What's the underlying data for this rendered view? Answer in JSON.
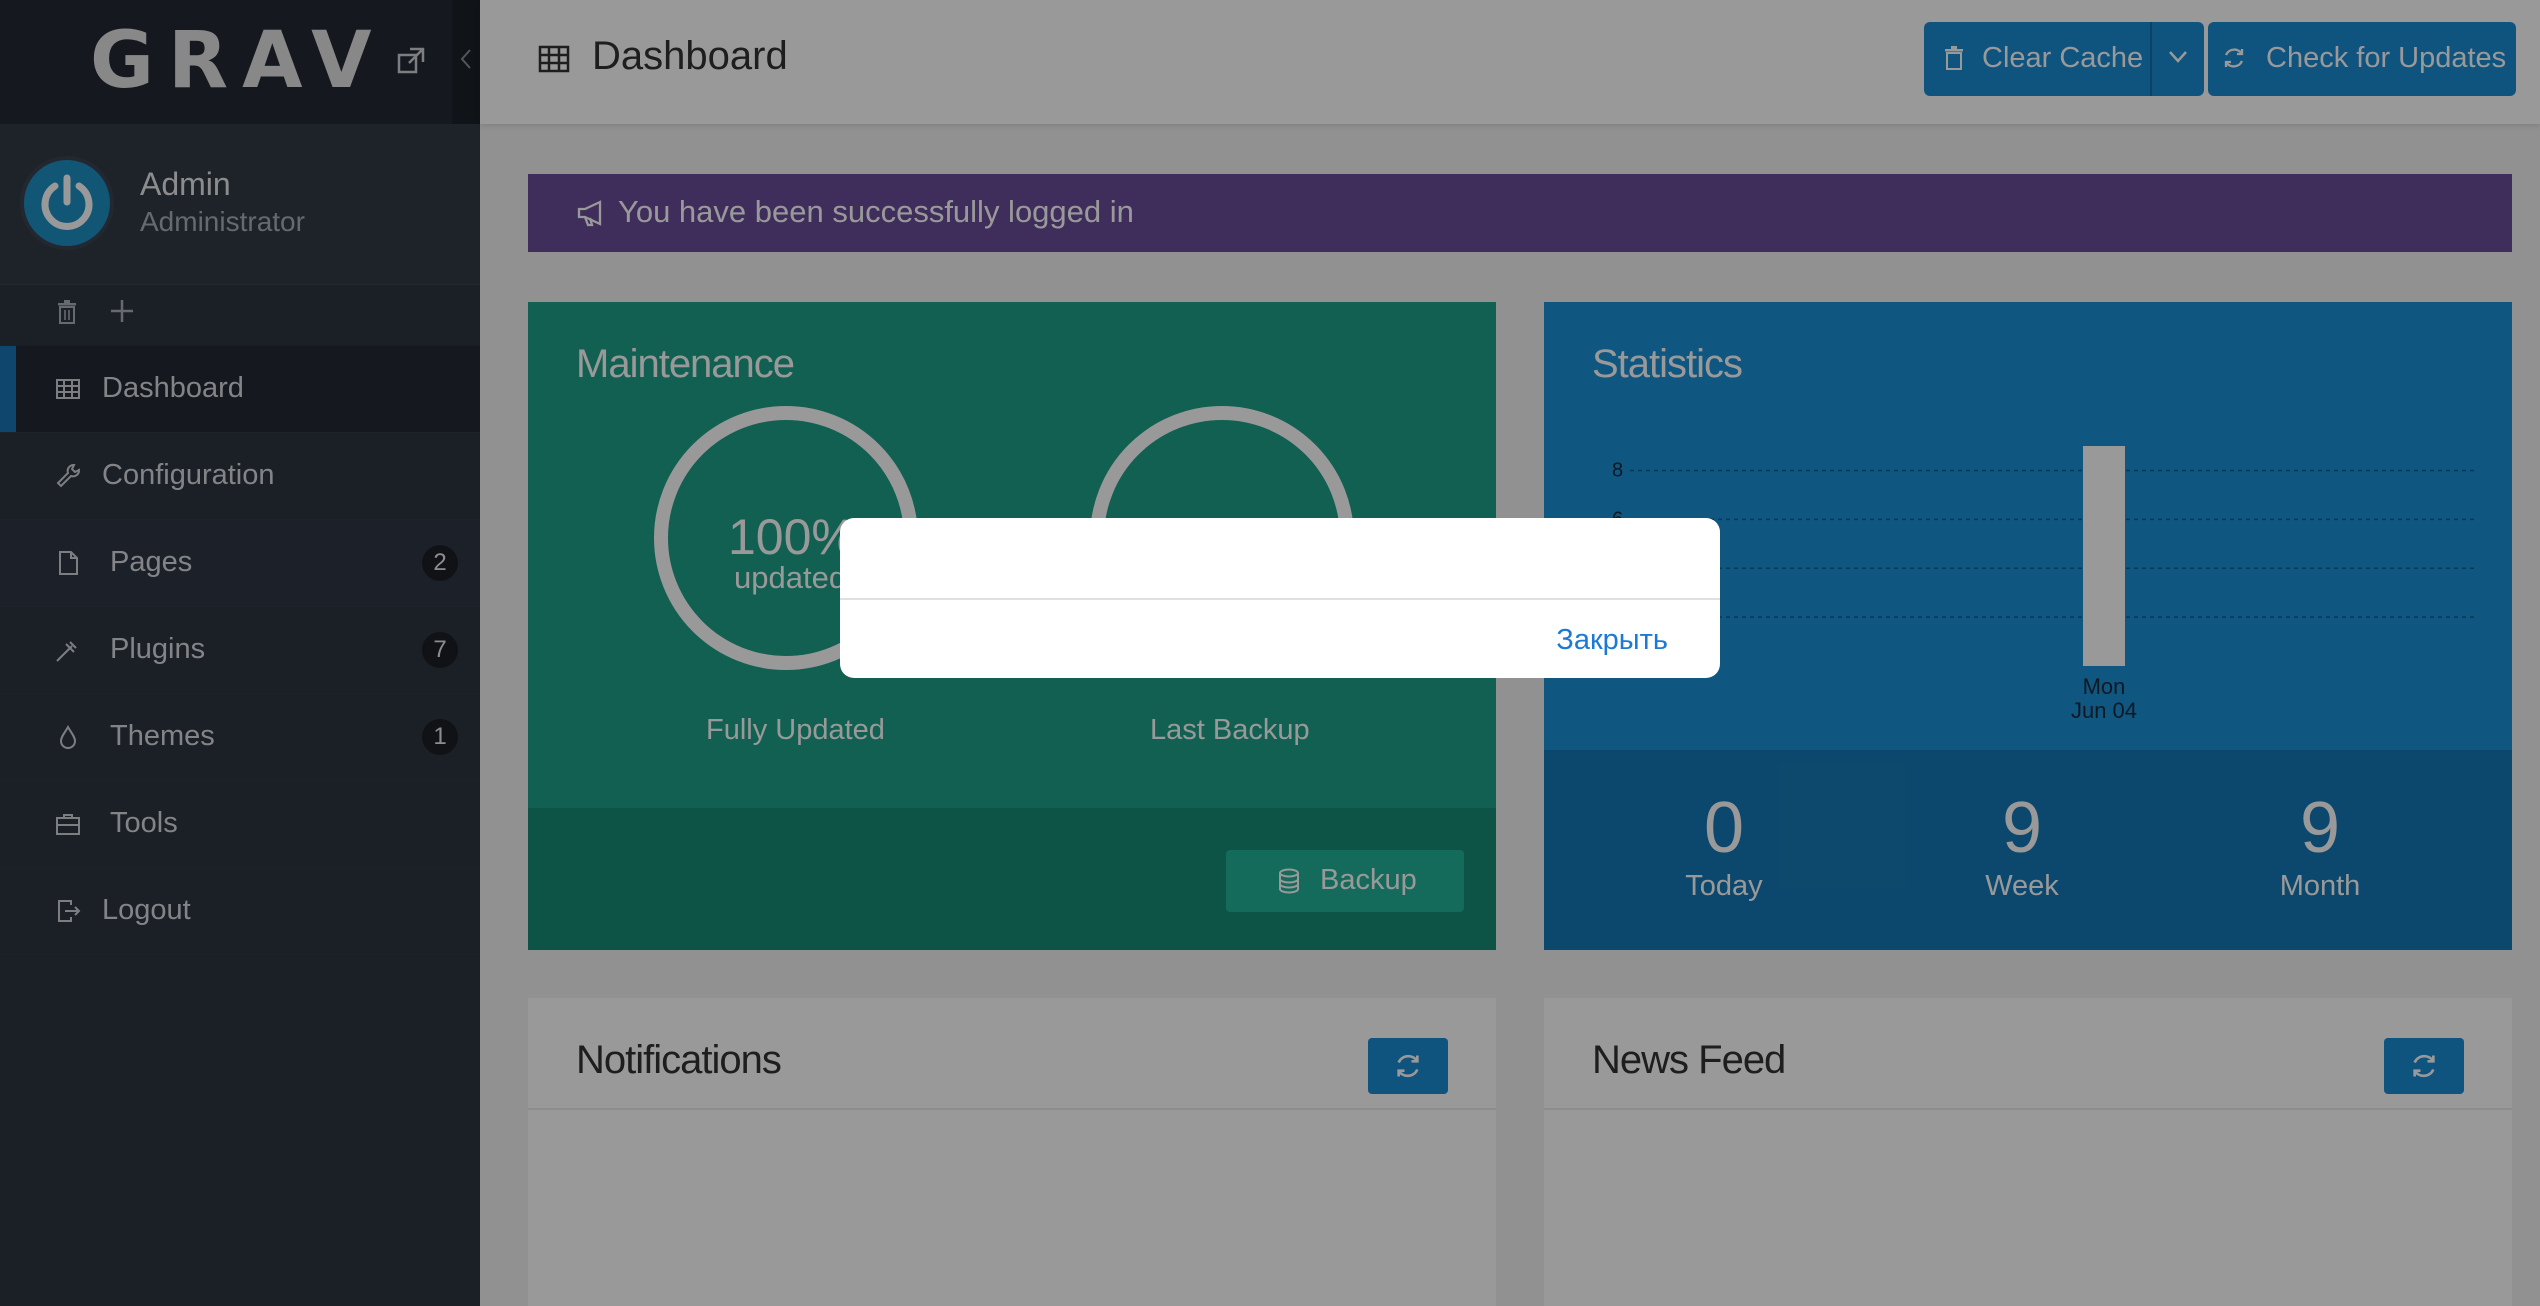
{
  "sidebar": {
    "logo": "GRAV",
    "user": {
      "name": "Admin",
      "role": "Administrator"
    },
    "nav": [
      {
        "label": "Dashboard",
        "icon": "dashboard-icon",
        "active": true
      },
      {
        "label": "Configuration",
        "icon": "wrench-icon"
      },
      {
        "label": "Pages",
        "icon": "file-icon",
        "badge": "2"
      },
      {
        "label": "Plugins",
        "icon": "plug-icon",
        "badge": "7"
      },
      {
        "label": "Themes",
        "icon": "tint-icon",
        "badge": "1"
      },
      {
        "label": "Tools",
        "icon": "briefcase-icon"
      },
      {
        "label": "Logout",
        "icon": "logout-icon"
      }
    ]
  },
  "header": {
    "title": "Dashboard",
    "clear_cache": "Clear Cache",
    "check_updates": "Check for Updates"
  },
  "alert": {
    "text": "You have been successfully logged in"
  },
  "maintenance": {
    "title": "Maintenance",
    "percent": "100%",
    "percent_label": "updated",
    "updated_caption": "Fully Updated",
    "backup_caption": "Last Backup",
    "backup_button": "Backup"
  },
  "statistics": {
    "title": "Statistics",
    "chart_data": {
      "type": "bar",
      "categories": [
        "Mon Jun 04"
      ],
      "category_lines": [
        [
          "Mon",
          "Jun 04"
        ]
      ],
      "values": [
        9
      ],
      "ylim": [
        0,
        9
      ],
      "yticks": [
        "8",
        "6"
      ],
      "grid": true
    },
    "today": {
      "value": "0",
      "label": "Today"
    },
    "week": {
      "value": "9",
      "label": "Week"
    },
    "month": {
      "value": "9",
      "label": "Month"
    }
  },
  "notifications": {
    "title": "Notifications"
  },
  "news": {
    "title": "News Feed"
  },
  "modal": {
    "close_label": "Закрыть"
  },
  "colors": {
    "sidebar_bg": "#2d3440",
    "accent": "#1a8ad4",
    "maintenance": "#1da088",
    "statistics": "#1a8fd6",
    "alert": "#6a4d9a"
  }
}
